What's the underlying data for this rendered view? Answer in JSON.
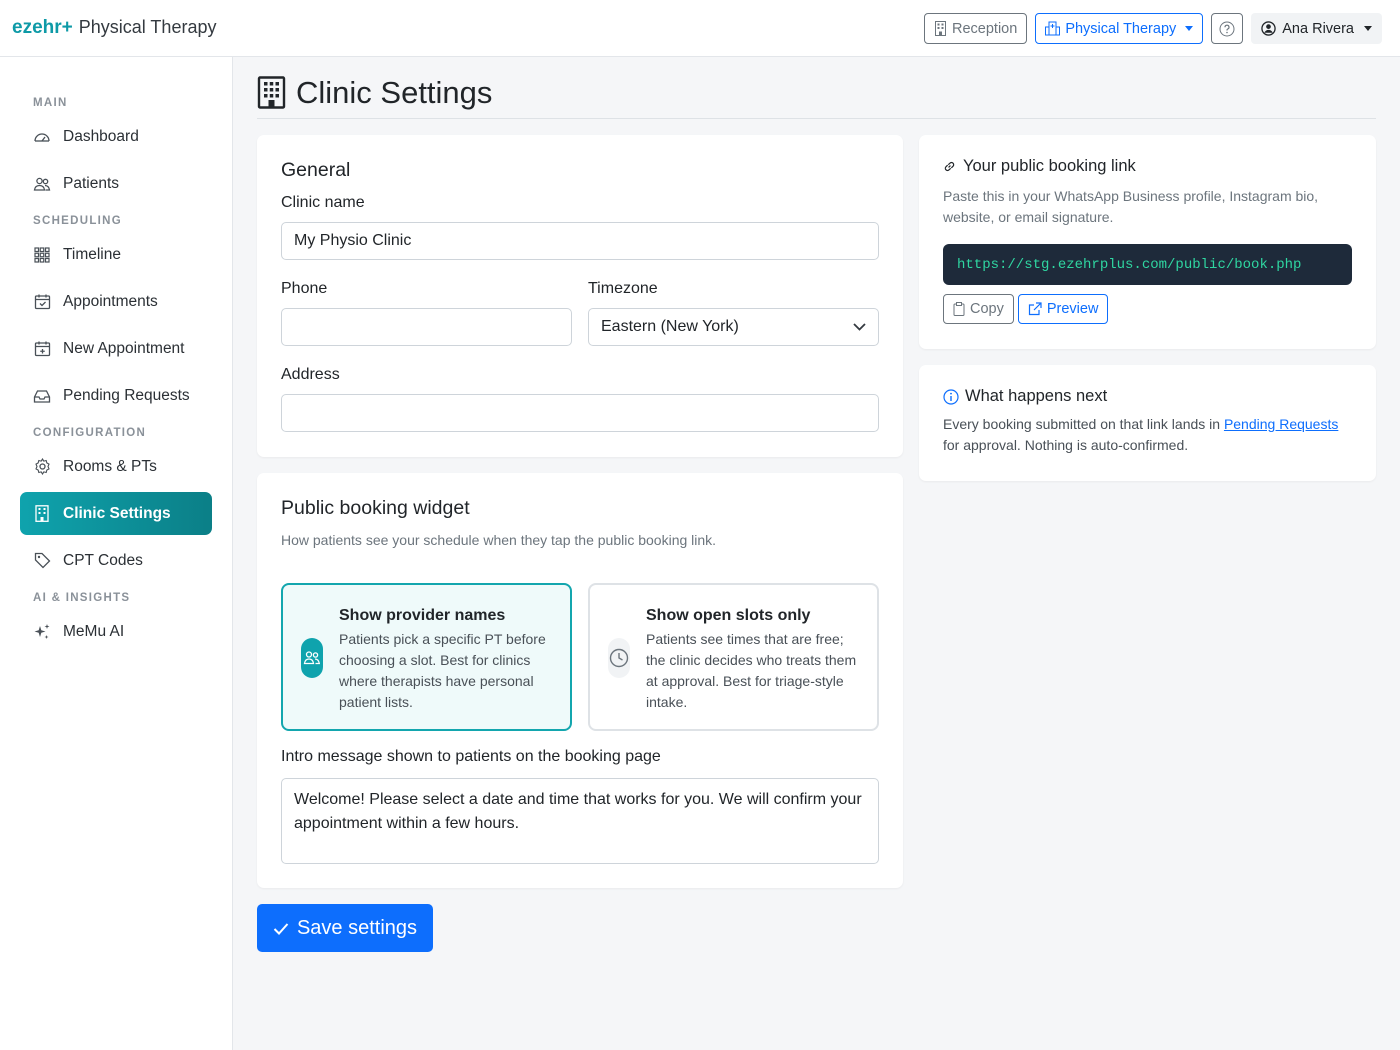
{
  "brand": {
    "logo": "ezehr+",
    "name": "Physical Therapy"
  },
  "topbar": {
    "reception_label": "Reception",
    "department_label": "Physical Therapy",
    "user_name": "Ana Rivera"
  },
  "sidebar": {
    "sections": [
      "MAIN",
      "SCHEDULING",
      "CONFIGURATION",
      "AI & INSIGHTS"
    ],
    "items": [
      {
        "label": "Dashboard",
        "icon": "speedometer-icon"
      },
      {
        "label": "Patients",
        "icon": "people-icon"
      },
      {
        "label": "Timeline",
        "icon": "grid-icon"
      },
      {
        "label": "Appointments",
        "icon": "calendar-check-icon"
      },
      {
        "label": "New Appointment",
        "icon": "calendar-plus-icon"
      },
      {
        "label": "Pending Requests",
        "icon": "inbox-icon"
      },
      {
        "label": "Rooms & PTs",
        "icon": "gear-icon"
      },
      {
        "label": "Clinic Settings",
        "icon": "building-icon",
        "active": true
      },
      {
        "label": "CPT Codes",
        "icon": "tag-icon"
      },
      {
        "label": "MeMu AI",
        "icon": "sparkles-icon"
      }
    ]
  },
  "page": {
    "title": "Clinic Settings"
  },
  "general": {
    "heading": "General",
    "clinic_name_label": "Clinic name",
    "clinic_name_value": "My Physio Clinic",
    "phone_label": "Phone",
    "phone_value": "",
    "timezone_label": "Timezone",
    "timezone_value": "Eastern (New York)",
    "address_label": "Address",
    "address_value": ""
  },
  "widget": {
    "heading": "Public booking widget",
    "subtitle": "How patients see your schedule when they tap the public booking link.",
    "option1_title": "Show provider names",
    "option1_desc": "Patients pick a specific PT before choosing a slot. Best for clinics where therapists have personal patient lists.",
    "option2_title": "Show open slots only",
    "option2_desc": "Patients see times that are free; the clinic decides who treats them at approval. Best for triage-style intake.",
    "selected": "Show provider names",
    "intro_label": "Intro message shown to patients on the booking page",
    "intro_value": "Welcome! Please select a date and time that works for you. We will confirm your appointment within a few hours."
  },
  "save_label": "Save settings",
  "booking_link": {
    "heading": "Your public booking link",
    "desc": "Paste this in your WhatsApp Business profile, Instagram bio, website, or email signature.",
    "url": "https://stg.ezehrplus.com/public/book.php",
    "copy_label": "Copy",
    "preview_label": "Preview"
  },
  "next": {
    "heading": "What happens next",
    "text_before": "Every booking submitted on that link lands in ",
    "link_text": "Pending Requests",
    "text_after": " for approval. Nothing is auto-confirmed."
  },
  "colors": {
    "accent": "#0fa3ad",
    "primary": "#0d6efd",
    "code_bg": "#1e2a3a",
    "code_text": "#2fd6a1"
  }
}
